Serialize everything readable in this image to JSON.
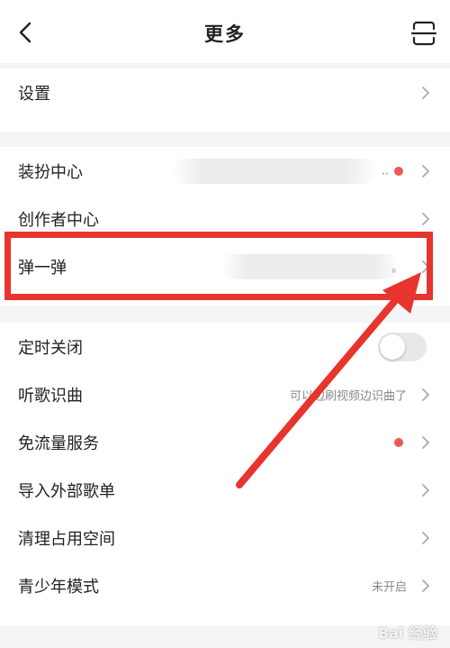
{
  "header": {
    "title": "更多"
  },
  "sections": [
    {
      "items": [
        {
          "label": "设置"
        }
      ]
    },
    {
      "items": [
        {
          "label": "装扮中心",
          "value": "..",
          "dot": true
        },
        {
          "label": "创作者中心"
        },
        {
          "label": "弹一弹",
          "value": "。"
        }
      ]
    },
    {
      "items": [
        {
          "label": "定时关闭",
          "toggle": false
        },
        {
          "label": "听歌识曲",
          "value": "可以边刷视频边识曲了"
        },
        {
          "label": "免流量服务",
          "dot": true
        },
        {
          "label": "导入外部歌单"
        },
        {
          "label": "清理占用空间"
        },
        {
          "label": "青少年模式",
          "value": "未开启"
        }
      ]
    }
  ],
  "watermark": "Bai 经验",
  "colors": {
    "accent": "#e8342e",
    "dot": "#e85a5a",
    "background": "#f5f5f7"
  }
}
